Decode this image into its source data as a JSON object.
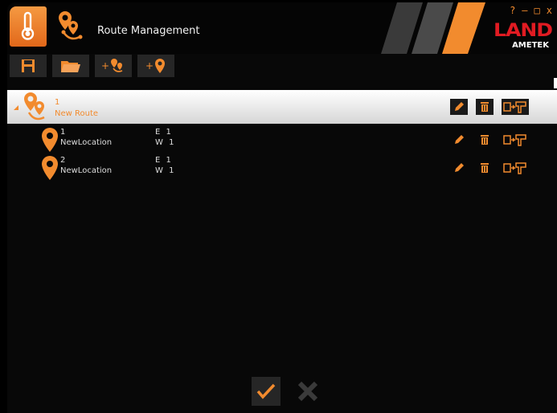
{
  "window": {
    "title": "Route Management",
    "controls": {
      "help": "?",
      "minimize": "–",
      "maximize": "□",
      "close": "x"
    },
    "brand": {
      "land": "LAND",
      "ametek": "AMETEK"
    },
    "accent": "#f28b2e"
  },
  "toolbar": {
    "items": [
      {
        "name": "save",
        "icon": "floppy-disk-icon"
      },
      {
        "name": "open",
        "icon": "folder-icon"
      },
      {
        "name": "add-route",
        "label": "+",
        "icon": "route-icon"
      },
      {
        "name": "add-location",
        "label": "+",
        "icon": "location-pin-icon"
      }
    ]
  },
  "route": {
    "number": "1",
    "name": "New Route",
    "expanded": true
  },
  "locations": [
    {
      "number": "1",
      "name": "NewLocation",
      "col1": "E 1",
      "col2": "W 1"
    },
    {
      "number": "2",
      "name": "NewLocation",
      "col1": "E 1",
      "col2": "W 1"
    }
  ],
  "footer": {
    "ok_icon": "check-icon",
    "cancel_icon": "close-x-icon"
  }
}
